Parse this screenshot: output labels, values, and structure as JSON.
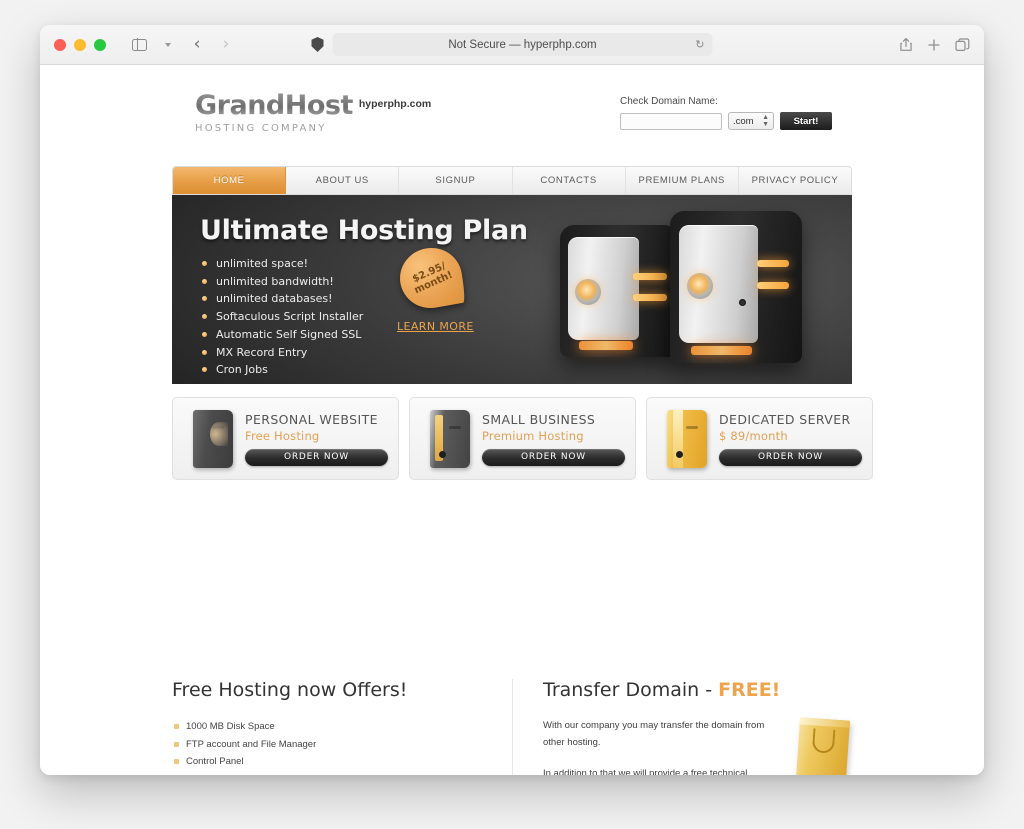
{
  "browser": {
    "url_text": "Not Secure — hyperphp.com",
    "reload_icon": "reload-icon",
    "shield_icon": "privacy-shield-icon",
    "sidebar_icon": "sidebar-icon",
    "chevron_icon": "chevron-down-icon",
    "back_icon": "‹",
    "forward_icon": "›",
    "reload_glyph": "↻",
    "share_icon": "share-icon",
    "new_tab_icon": "+",
    "tabs_icon": "tab-overview-icon"
  },
  "site": {
    "logo_main": "GrandHost",
    "logo_sub": "HOSTING COMPANY",
    "logo_tag": "hyperphp.com",
    "domain_check": {
      "label": "Check Domain Name:",
      "input_value": "",
      "input_placeholder": "",
      "tld": ".com",
      "button": "Start!"
    },
    "nav": [
      {
        "label": "HOME",
        "active": true
      },
      {
        "label": "ABOUT US",
        "active": false
      },
      {
        "label": "SIGNUP",
        "active": false
      },
      {
        "label": "CONTACTS",
        "active": false
      },
      {
        "label": "PREMIUM PLANS",
        "active": false
      },
      {
        "label": "PRIVACY POLICY",
        "active": false
      }
    ],
    "hero": {
      "title": "Ultimate Hosting Plan",
      "features": [
        "unlimited space!",
        "unlimited bandwidth!",
        "unlimited databases!",
        "Softaculous Script Installer",
        "Automatic Self Signed SSL",
        "MX Record Entry",
        "Cron Jobs"
      ],
      "badge_line1": "$2.95/",
      "badge_line2": "month!",
      "learn_more": "LEARN MORE"
    },
    "plans": [
      {
        "title": "PERSONAL WEBSITE",
        "sub": "Free Hosting",
        "button": "ORDER NOW",
        "icon": "binder-dark-icon"
      },
      {
        "title": "SMALL BUSINESS",
        "sub": "Premium Hosting",
        "button": "ORDER NOW",
        "icon": "binder-gray-icon"
      },
      {
        "title": "DEDICATED SERVER",
        "sub": "$ 89/month",
        "button": "ORDER NOW",
        "icon": "binder-yellow-icon"
      }
    ],
    "offers": {
      "title": "Free Hosting now Offers!",
      "items": [
        "1000 MB Disk Space",
        "FTP account and File Manager",
        "Control Panel"
      ]
    },
    "transfer": {
      "title_plain": "Transfer Domain - ",
      "title_accent": "FREE!",
      "paragraph1": "With our company you may transfer the domain from other hosting.",
      "paragraph2": "In addition to that we will provide a free technical"
    }
  },
  "colors": {
    "accent_orange": "#e8a049",
    "hero_bg": "#232323",
    "button_dark": "#1c1c1c"
  }
}
